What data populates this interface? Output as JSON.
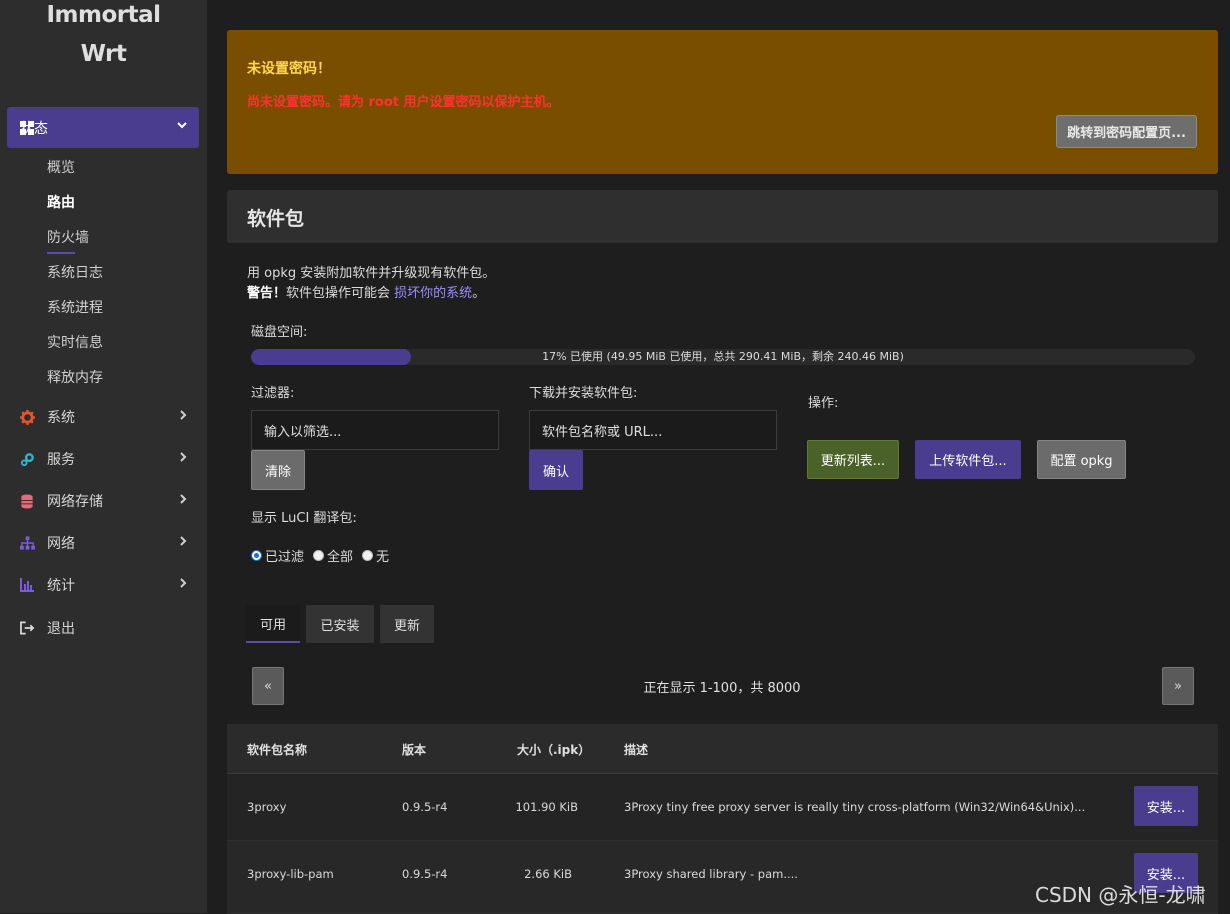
{
  "brand": {
    "line1": "Immortal",
    "line2": "Wrt"
  },
  "sidebar": {
    "active": {
      "label": "状态",
      "icon": "dashboard-icon"
    },
    "subitems": [
      "概览",
      "路由",
      "防火墙",
      "系统日志",
      "系统进程",
      "实时信息",
      "释放内存"
    ],
    "items": [
      {
        "label": "系统",
        "icon": "gear-icon",
        "color": "#e8542a"
      },
      {
        "label": "服务",
        "icon": "cogs-icon",
        "color": "#2fb5d0"
      },
      {
        "label": "网络存储",
        "icon": "database-icon",
        "color": "#e86a7a"
      },
      {
        "label": "网络",
        "icon": "sitemap-icon",
        "color": "#7b5be0"
      },
      {
        "label": "统计",
        "icon": "bar-chart-icon",
        "color": "#7b5be0"
      },
      {
        "label": "退出",
        "icon": "logout-icon",
        "color": "#dcdcdc"
      }
    ]
  },
  "alert": {
    "title": "未设置密码！",
    "text": "尚未设置密码。请为 root 用户设置密码以保护主机。",
    "button": "跳转到密码配置页..."
  },
  "section": {
    "title": "软件包"
  },
  "description": {
    "line1": "用 opkg 安装附加软件并升级现有软件包。",
    "warn_prefix": "警告！",
    "warn_mid": "软件包操作可能会",
    "warn_link": "损坏你的系统",
    "warn_suffix": "。"
  },
  "disk": {
    "label": "磁盘空间:",
    "used_fraction": 0.17,
    "text": "17% 已使用 (49.95 MiB 已使用，总共 290.41 MiB，剩余 240.46 MiB)"
  },
  "filter": {
    "label": "过滤器:",
    "placeholder": "输入以筛选...",
    "clear": "清除"
  },
  "download": {
    "label": "下载并安装软件包:",
    "placeholder": "软件包名称或 URL...",
    "confirm": "确认"
  },
  "actions": {
    "label": "操作:",
    "update": "更新列表...",
    "upload": "上传软件包...",
    "config": "配置 opkg"
  },
  "luci": {
    "label": "显示 LuCI 翻译包:",
    "options": [
      "已过滤",
      "全部",
      "无"
    ],
    "selected": "已过滤"
  },
  "tabs": [
    "可用",
    "已安装",
    "更新"
  ],
  "pager": {
    "prev": "«",
    "next": "»",
    "text": "正在显示 1-100，共 8000"
  },
  "table": {
    "headers": [
      "软件包名称",
      "版本",
      "大小（.ipk）",
      "描述"
    ],
    "rows": [
      {
        "name": "3proxy",
        "version": "0.9.5-r4",
        "size": "101.90 KiB",
        "desc": "3Proxy tiny free proxy server is really tiny cross-platform (Win32/Win64&Unix)...",
        "action": "安装..."
      },
      {
        "name": "3proxy-lib-pam",
        "version": "0.9.5-r4",
        "size": "2.66 KiB",
        "desc": "3Proxy shared library - pam....",
        "action": "安装..."
      }
    ]
  },
  "watermark": "CSDN @永恒-龙啸"
}
